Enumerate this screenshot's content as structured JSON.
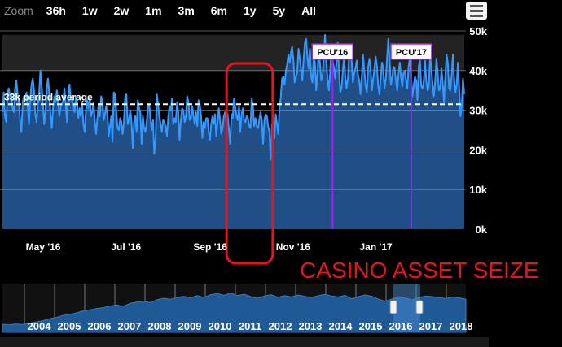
{
  "zoom": {
    "label": "Zoom",
    "buttons": [
      "36h",
      "1w",
      "2w",
      "1m",
      "3m",
      "6m",
      "1y",
      "5y",
      "All"
    ]
  },
  "colors": {
    "background": "#000000",
    "series": "#3399ff",
    "area": "#1f4f86",
    "plot_band": "#232323",
    "pcu_line": "#a020f0",
    "annotation": "#e8141c",
    "average_line": "#ffffff"
  },
  "chart_data": {
    "type": "line",
    "y_ticks": [
      "0k",
      "10k",
      "20k",
      "30k",
      "40k",
      "50k"
    ],
    "ylim": [
      0,
      50000
    ],
    "x_ticks": [
      "May '16",
      "Jul '16",
      "Sep '16",
      "Nov '16",
      "Jan '17"
    ],
    "xlim": [
      "2016-04-01",
      "2017-03-07"
    ],
    "average": {
      "label": "33k period average",
      "value": 31500
    },
    "markers": [
      {
        "label": "PCU'16",
        "date": "2016-11-30"
      },
      {
        "label": "PCU'17",
        "date": "2017-01-27"
      }
    ],
    "annotation_text": "CASINO ASSET SEIZE",
    "highlight_range": [
      "2016-09-13",
      "2016-10-17"
    ],
    "series": [
      {
        "values": [
          [
            29500,
            34500,
            28500,
            27000,
            34500,
            35500,
            33500,
            34000,
            30500,
            29500,
            35500,
            37500,
            34000,
            32000,
            27500,
            24500,
            32000,
            33500,
            32500,
            34500,
            31000,
            26500,
            33000,
            36500,
            38000,
            35000,
            29000,
            27000,
            31500,
            34000,
            40000,
            36000,
            31500,
            26500,
            30000,
            35500,
            38000,
            34500,
            29000,
            25500,
            30500,
            33500,
            32000,
            35000,
            32000,
            28500,
            31000,
            31500,
            32500,
            35500,
            31500,
            27000,
            33500,
            36500,
            33000,
            32500,
            31500,
            29500,
            33500,
            32000,
            28000
          ],
          [
            30500,
            28500,
            32000,
            26500,
            24500,
            30000,
            32500,
            30500,
            33000,
            28500,
            29500,
            32000,
            27500,
            24000,
            28000,
            31500,
            28500,
            33500,
            32500,
            27500,
            29000,
            31000,
            29000,
            23500,
            26000,
            28500,
            22000,
            34500,
            34000,
            29500,
            25500,
            25000,
            28000,
            27000,
            24000,
            27000,
            33500,
            34000,
            26500,
            27500,
            30000,
            27500,
            20500,
            27000,
            28500,
            24500,
            32500,
            30500,
            29500,
            21500,
            28500,
            25500,
            24500,
            27000,
            31000,
            31500,
            28000,
            25000,
            27500,
            19000,
            22500
          ],
          [
            34000,
            31500,
            28500,
            26500,
            24500,
            27500,
            27000,
            26000,
            23500,
            28000,
            31000,
            30000,
            33000,
            26500,
            28000,
            27000,
            32000,
            29500,
            22500,
            27500,
            30500,
            30000,
            27000,
            28500,
            33500,
            32000,
            27500,
            28000,
            31000,
            28500,
            26500,
            29500,
            26000,
            32500,
            31500,
            28500,
            23000,
            27000,
            25500,
            28000,
            28000,
            24500,
            22500,
            26500,
            28500,
            26500,
            29000,
            23500,
            27000,
            30500,
            27500,
            24000,
            25500,
            28500,
            29500,
            26500,
            29000,
            25000,
            21500,
            29000,
            28000
          ],
          [
            33000,
            31000,
            28500,
            27500,
            31000,
            24500,
            29000,
            30500,
            27500,
            27000,
            28500,
            28000,
            26000,
            25500,
            33000,
            31000,
            26000,
            28000,
            26000,
            25500,
            27500,
            29500,
            27500,
            21500,
            27500,
            29000,
            28500,
            26000,
            24500,
            17500,
            26500,
            27500,
            23000,
            29000,
            26500,
            24000,
            30500,
            33500,
            38000,
            38500,
            36500,
            40000,
            41500,
            44000,
            42000,
            44500,
            46000,
            42500,
            37000,
            38500,
            39500,
            45500,
            43000,
            40500,
            37500,
            42500,
            47000,
            48000,
            43500,
            40500,
            45500
          ],
          [
            38500,
            37000,
            43500,
            42000,
            35000,
            39500,
            45000,
            41500,
            37500,
            38500,
            44000,
            49000,
            42000,
            38000,
            35000,
            39500,
            45000,
            42500,
            40500,
            38000,
            42000,
            47000,
            40000,
            34500,
            35500,
            40000,
            43500,
            38500,
            35500,
            38000,
            43500,
            46500,
            42500,
            37000,
            39500,
            40500,
            42500,
            39000,
            37500,
            34000,
            38500,
            44000,
            40000,
            36500,
            34500,
            40500,
            43000,
            41000,
            35000,
            38000,
            40500,
            43500,
            41000,
            36000,
            34000,
            38500,
            42000,
            40500,
            35500,
            38000,
            43000
          ],
          [
            48000,
            43000,
            36500,
            38000,
            41000,
            40500,
            37500,
            35000,
            39000,
            42000,
            38500,
            36000,
            39500,
            40000,
            37500,
            35500,
            41000,
            43000,
            38500,
            33500,
            36000,
            38500,
            37500,
            32500,
            41000,
            42500,
            36000,
            35500,
            37500,
            42500,
            37500,
            35000,
            36000,
            44000,
            40500,
            36500,
            33500,
            37500,
            43000,
            39500,
            35000,
            35500,
            40500,
            37000,
            32000,
            38500,
            44000,
            42000,
            35500,
            35000,
            39000,
            44000,
            38000,
            34500,
            36500,
            42000,
            35500,
            28500,
            31000,
            38000,
            34000
          ]
        ]
      }
    ],
    "navigator": {
      "years": [
        "2004",
        "2005",
        "2006",
        "2007",
        "2008",
        "2009",
        "2010",
        "2011",
        "2012",
        "2013",
        "2014",
        "2015",
        "2016",
        "2017",
        "2018"
      ],
      "values": [
        2500,
        2300,
        2600,
        2400,
        2800,
        3200,
        3600,
        4200,
        4600,
        5200,
        5500,
        6000,
        6600,
        6900,
        7300,
        7600,
        8100,
        8400,
        8000,
        8900,
        9300,
        9600,
        9200,
        10000,
        10500,
        10200,
        10700,
        11100,
        10600,
        11300,
        10800,
        11600,
        11900,
        11400,
        12100,
        11300,
        11700,
        11000,
        10500,
        11200,
        11600,
        10800,
        11300,
        10900,
        11500,
        11100,
        10700,
        11300,
        11700,
        11200,
        10900,
        11400,
        10300,
        11000,
        11500,
        11100,
        10200,
        9600,
        10300,
        11000,
        10500,
        10000,
        10700,
        11200,
        11000,
        10700,
        10400,
        10900,
        10600,
        10200
      ]
    }
  }
}
